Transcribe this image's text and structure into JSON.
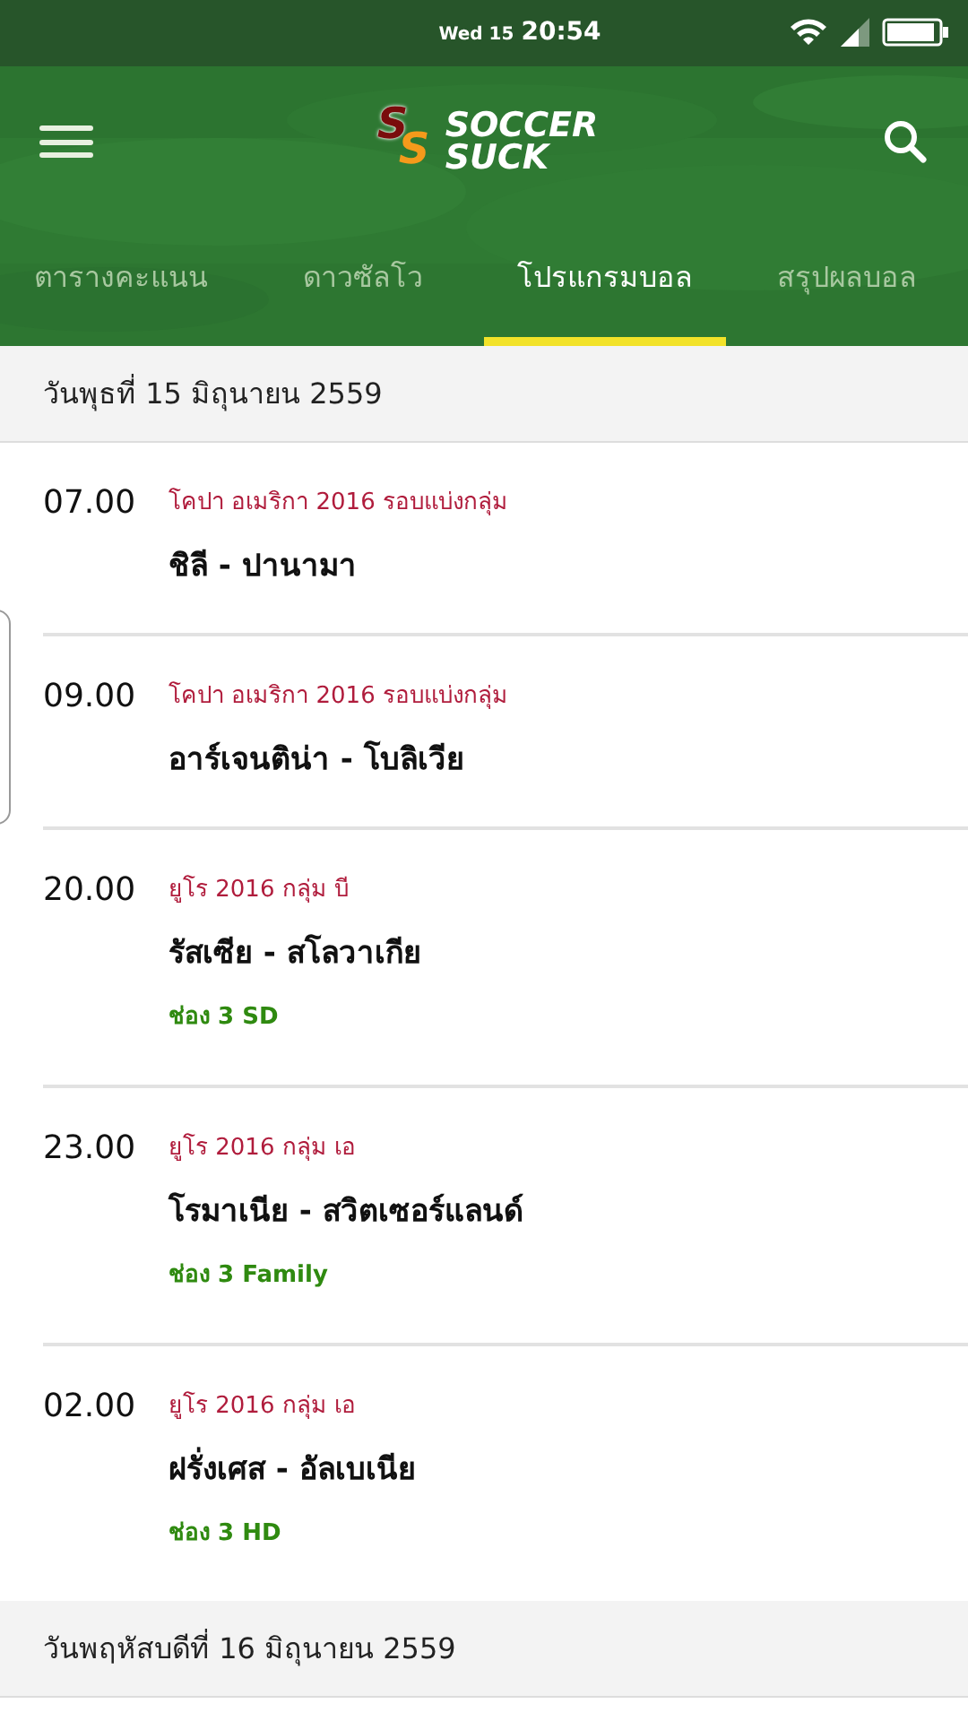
{
  "status_bar": {
    "day": "Wed 15",
    "time": "20:54"
  },
  "logo": {
    "mark_letters": [
      "S",
      "S"
    ],
    "words": [
      "SOCCER",
      "SUCK"
    ]
  },
  "tabs": [
    {
      "label": "ตารางคะแนน",
      "selected": false
    },
    {
      "label": "ดาวซัลโว",
      "selected": false
    },
    {
      "label": "โปรแกรมบอล",
      "selected": true
    },
    {
      "label": "สรุปผลบอล",
      "selected": false
    }
  ],
  "days": [
    {
      "date": "วันพุธที่ 15 มิถุนายน 2559",
      "matches": [
        {
          "time": "07.00",
          "competition": "โคปา อเมริกา 2016 รอบแบ่งกลุ่ม",
          "teams": "ชิลี - ปานามา"
        },
        {
          "time": "09.00",
          "competition": "โคปา อเมริกา 2016 รอบแบ่งกลุ่ม",
          "teams": "อาร์เจนติน่า - โบลิเวีย"
        },
        {
          "time": "20.00",
          "competition": "ยูโร 2016 กลุ่ม บี",
          "teams": "รัสเซีย - สโลวาเกีย",
          "channel": "ช่อง 3 SD"
        },
        {
          "time": "23.00",
          "competition": "ยูโร 2016 กลุ่ม เอ",
          "teams": "โรมาเนีย - สวิตเซอร์แลนด์",
          "channel": "ช่อง 3 Family"
        },
        {
          "time": "02.00",
          "competition": "ยูโร 2016 กลุ่ม เอ",
          "teams": "ฝรั่งเศส - อัลเบเนีย",
          "channel": "ช่อง 3 HD"
        }
      ]
    },
    {
      "date": "วันพฤหัสบดีที่ 16 มิถุนายน 2559"
    }
  ]
}
